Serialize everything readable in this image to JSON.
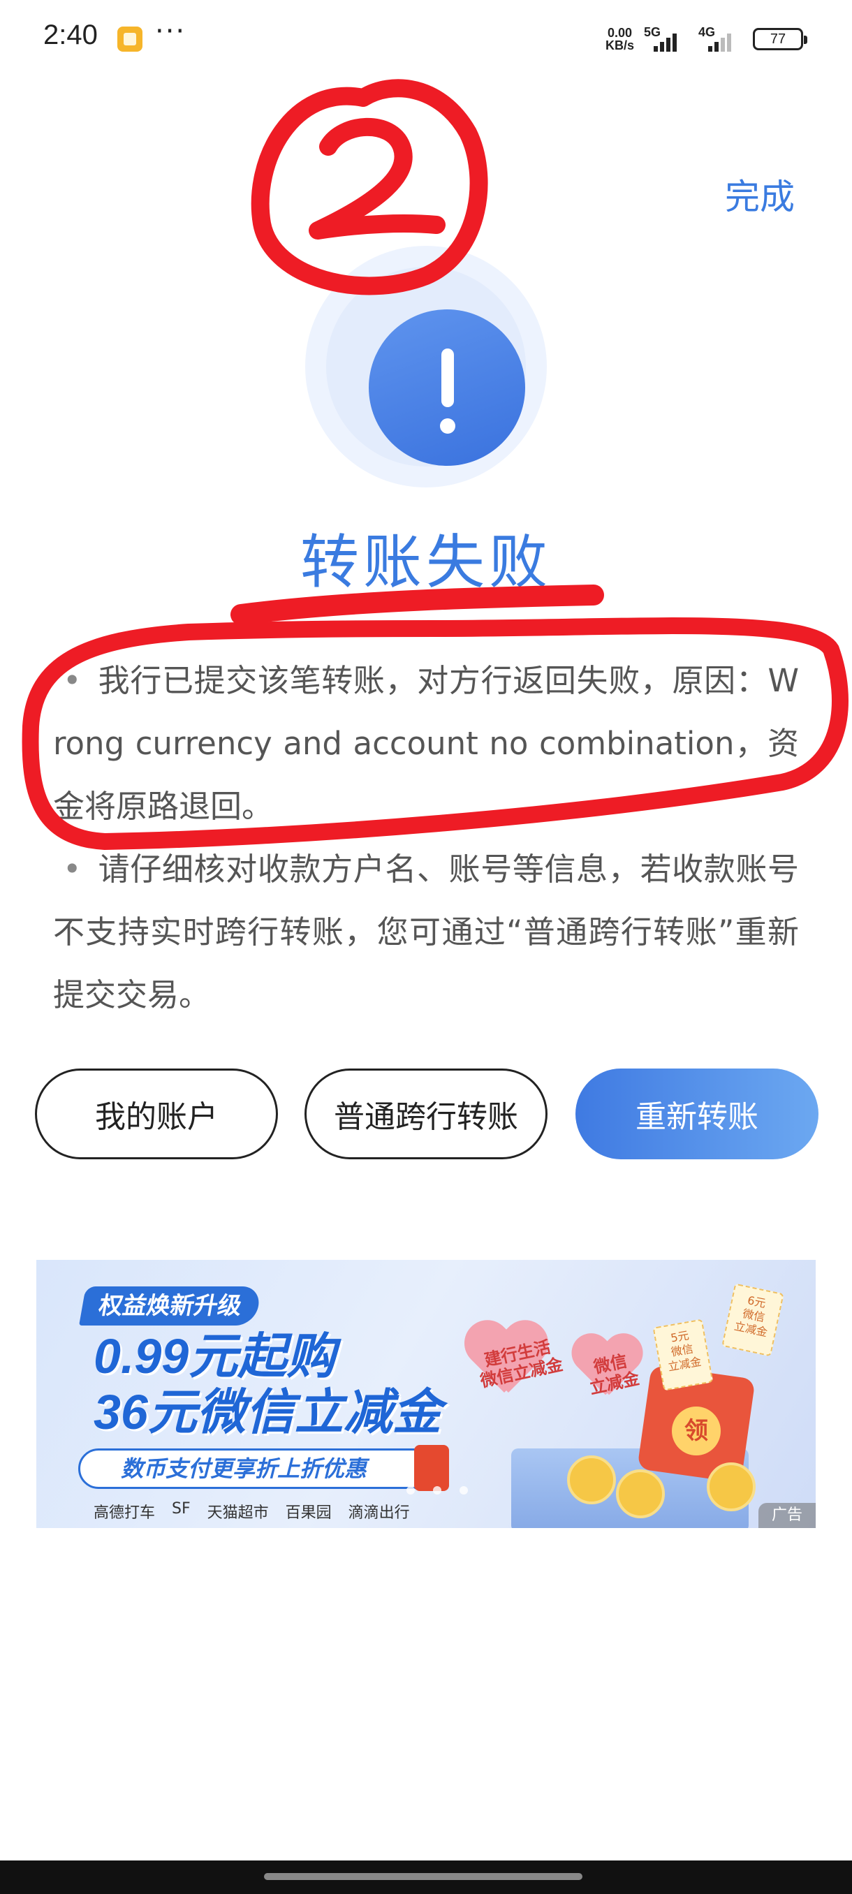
{
  "status_bar": {
    "time": "2:40",
    "more": "···",
    "net_speed_value": "0.00",
    "net_speed_unit": "KB/s",
    "sim1": "5G",
    "sim2": "4G",
    "battery": "77"
  },
  "header": {
    "done_label": "完成"
  },
  "result": {
    "icon": "exclamation-circle-icon",
    "title": "转账失败",
    "message_1": "我行已提交该笔转账，对方行返回失败，原因：Wrong currency and account no combination，资金将原路退回。",
    "message_2": "请仔细核对收款方户名、账号等信息，若收款账号不支持实时跨行转账，您可通过“普通跨行转账”重新提交交易。",
    "bullet": "•"
  },
  "actions": {
    "my_account": "我的账户",
    "ordinary_transfer": "普通跨行转账",
    "retry_transfer": "重新转账"
  },
  "ad": {
    "tag": "权益焕新升级",
    "headline_1": "0.99元起购",
    "headline_2": "36元微信立减金",
    "pill": "数币支付更享折上折优惠",
    "partners": [
      "高德打车",
      "SF",
      "天猫超市",
      "百果园",
      "滴滴出行"
    ],
    "heart_1": "建行生活\n微信立减金",
    "heart_2": "微信\n立减金",
    "seal": "领",
    "ticket_1": "5元\n微信\n立减金",
    "ticket_2": "6元\n微信\n立减金",
    "corner_label": "广告"
  },
  "annotation": {
    "number": "2",
    "color": "#ee1c25"
  },
  "colors": {
    "accent": "#3a7be0",
    "button_gradient_start": "#3f7ae2",
    "button_gradient_end": "#6ca8f1"
  }
}
